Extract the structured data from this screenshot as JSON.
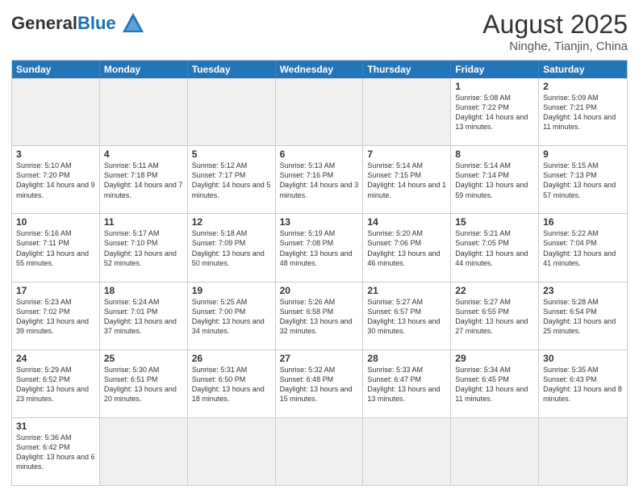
{
  "header": {
    "logo_general": "General",
    "logo_blue": "Blue",
    "title": "August 2025",
    "location": "Ninghe, Tianjin, China"
  },
  "weekdays": [
    "Sunday",
    "Monday",
    "Tuesday",
    "Wednesday",
    "Thursday",
    "Friday",
    "Saturday"
  ],
  "weeks": [
    [
      {
        "day": "",
        "empty": true
      },
      {
        "day": "",
        "empty": true
      },
      {
        "day": "",
        "empty": true
      },
      {
        "day": "",
        "empty": true
      },
      {
        "day": "",
        "empty": true
      },
      {
        "day": "1",
        "info": "Sunrise: 5:08 AM\nSunset: 7:22 PM\nDaylight: 14 hours and 13 minutes."
      },
      {
        "day": "2",
        "info": "Sunrise: 5:09 AM\nSunset: 7:21 PM\nDaylight: 14 hours and 11 minutes."
      }
    ],
    [
      {
        "day": "3",
        "info": "Sunrise: 5:10 AM\nSunset: 7:20 PM\nDaylight: 14 hours and 9 minutes."
      },
      {
        "day": "4",
        "info": "Sunrise: 5:11 AM\nSunset: 7:18 PM\nDaylight: 14 hours and 7 minutes."
      },
      {
        "day": "5",
        "info": "Sunrise: 5:12 AM\nSunset: 7:17 PM\nDaylight: 14 hours and 5 minutes."
      },
      {
        "day": "6",
        "info": "Sunrise: 5:13 AM\nSunset: 7:16 PM\nDaylight: 14 hours and 3 minutes."
      },
      {
        "day": "7",
        "info": "Sunrise: 5:14 AM\nSunset: 7:15 PM\nDaylight: 14 hours and 1 minute."
      },
      {
        "day": "8",
        "info": "Sunrise: 5:14 AM\nSunset: 7:14 PM\nDaylight: 13 hours and 59 minutes."
      },
      {
        "day": "9",
        "info": "Sunrise: 5:15 AM\nSunset: 7:13 PM\nDaylight: 13 hours and 57 minutes."
      }
    ],
    [
      {
        "day": "10",
        "info": "Sunrise: 5:16 AM\nSunset: 7:11 PM\nDaylight: 13 hours and 55 minutes."
      },
      {
        "day": "11",
        "info": "Sunrise: 5:17 AM\nSunset: 7:10 PM\nDaylight: 13 hours and 52 minutes."
      },
      {
        "day": "12",
        "info": "Sunrise: 5:18 AM\nSunset: 7:09 PM\nDaylight: 13 hours and 50 minutes."
      },
      {
        "day": "13",
        "info": "Sunrise: 5:19 AM\nSunset: 7:08 PM\nDaylight: 13 hours and 48 minutes."
      },
      {
        "day": "14",
        "info": "Sunrise: 5:20 AM\nSunset: 7:06 PM\nDaylight: 13 hours and 46 minutes."
      },
      {
        "day": "15",
        "info": "Sunrise: 5:21 AM\nSunset: 7:05 PM\nDaylight: 13 hours and 44 minutes."
      },
      {
        "day": "16",
        "info": "Sunrise: 5:22 AM\nSunset: 7:04 PM\nDaylight: 13 hours and 41 minutes."
      }
    ],
    [
      {
        "day": "17",
        "info": "Sunrise: 5:23 AM\nSunset: 7:02 PM\nDaylight: 13 hours and 39 minutes."
      },
      {
        "day": "18",
        "info": "Sunrise: 5:24 AM\nSunset: 7:01 PM\nDaylight: 13 hours and 37 minutes."
      },
      {
        "day": "19",
        "info": "Sunrise: 5:25 AM\nSunset: 7:00 PM\nDaylight: 13 hours and 34 minutes."
      },
      {
        "day": "20",
        "info": "Sunrise: 5:26 AM\nSunset: 6:58 PM\nDaylight: 13 hours and 32 minutes."
      },
      {
        "day": "21",
        "info": "Sunrise: 5:27 AM\nSunset: 6:57 PM\nDaylight: 13 hours and 30 minutes."
      },
      {
        "day": "22",
        "info": "Sunrise: 5:27 AM\nSunset: 6:55 PM\nDaylight: 13 hours and 27 minutes."
      },
      {
        "day": "23",
        "info": "Sunrise: 5:28 AM\nSunset: 6:54 PM\nDaylight: 13 hours and 25 minutes."
      }
    ],
    [
      {
        "day": "24",
        "info": "Sunrise: 5:29 AM\nSunset: 6:52 PM\nDaylight: 13 hours and 23 minutes."
      },
      {
        "day": "25",
        "info": "Sunrise: 5:30 AM\nSunset: 6:51 PM\nDaylight: 13 hours and 20 minutes."
      },
      {
        "day": "26",
        "info": "Sunrise: 5:31 AM\nSunset: 6:50 PM\nDaylight: 13 hours and 18 minutes."
      },
      {
        "day": "27",
        "info": "Sunrise: 5:32 AM\nSunset: 6:48 PM\nDaylight: 13 hours and 15 minutes."
      },
      {
        "day": "28",
        "info": "Sunrise: 5:33 AM\nSunset: 6:47 PM\nDaylight: 13 hours and 13 minutes."
      },
      {
        "day": "29",
        "info": "Sunrise: 5:34 AM\nSunset: 6:45 PM\nDaylight: 13 hours and 11 minutes."
      },
      {
        "day": "30",
        "info": "Sunrise: 5:35 AM\nSunset: 6:43 PM\nDaylight: 13 hours and 8 minutes."
      }
    ],
    [
      {
        "day": "31",
        "info": "Sunrise: 5:36 AM\nSunset: 6:42 PM\nDaylight: 13 hours and 6 minutes."
      },
      {
        "day": "",
        "empty": true
      },
      {
        "day": "",
        "empty": true
      },
      {
        "day": "",
        "empty": true
      },
      {
        "day": "",
        "empty": true
      },
      {
        "day": "",
        "empty": true
      },
      {
        "day": "",
        "empty": true
      }
    ]
  ]
}
